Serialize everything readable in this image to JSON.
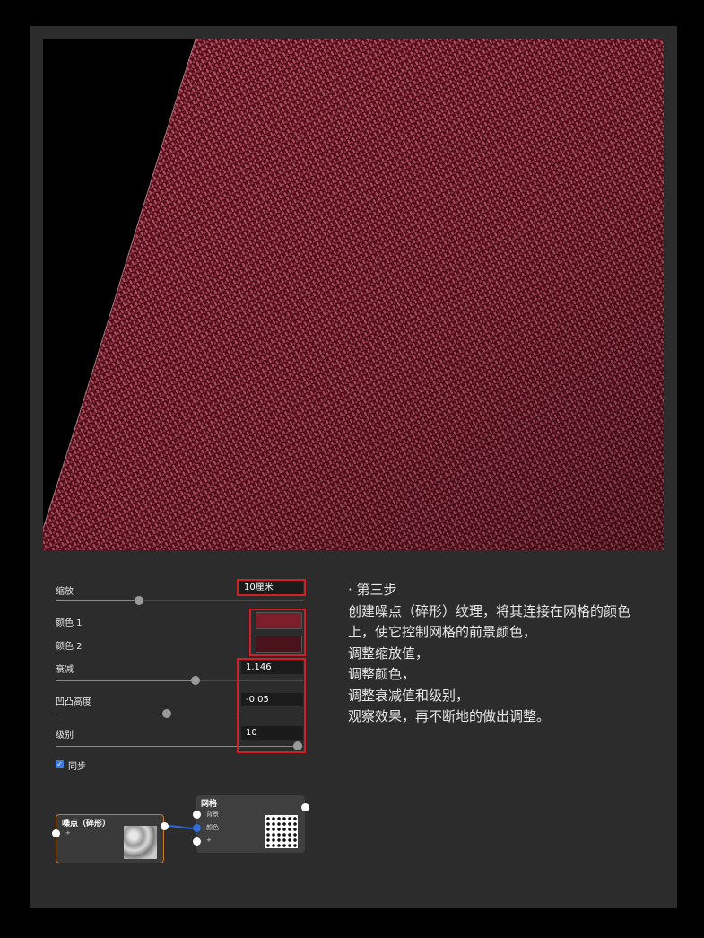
{
  "params": {
    "scale_label": "缩放",
    "scale_value": "10厘米",
    "scale_slider": 0.33,
    "color1_label": "颜色 1",
    "color1_hex": "#7d1e2c",
    "color2_label": "颜色 2",
    "color2_hex": "#4a121b",
    "falloff_label": "衰减",
    "falloff_value": "1.146",
    "falloff_slider": 0.6,
    "bump_label": "凹凸高度",
    "bump_value": "-0.05",
    "bump_slider": 0.45,
    "level_label": "级别",
    "level_value": "10",
    "level_slider": 1.0,
    "sync_label": "同步",
    "sync_checked": true
  },
  "nodes": {
    "noise": {
      "title": "噪点（碎形）",
      "port_label": "+"
    },
    "grid": {
      "title": "网格",
      "port_bg": "背景",
      "port_color": "颜色",
      "port_add": "+"
    }
  },
  "instructions": {
    "lines": [
      "· 第三步",
      "创建噪点（碎形）纹理，将其连接在网格的颜色",
      "上，使它控制网格的前景颜色，",
      "调整缩放值，",
      "调整颜色，",
      "调整衰减值和级别，",
      "观察效果，再不断地的做出调整。"
    ]
  },
  "colors": {
    "highlight_red": "#d01f26",
    "fabric_dark": "#5a0f1c",
    "fabric_light": "#c45a6a",
    "noise_border": "#c07a2a",
    "link_blue": "#2f6bd8",
    "checkbox_blue": "#3d7de0"
  },
  "icons": {
    "check": "✓"
  }
}
